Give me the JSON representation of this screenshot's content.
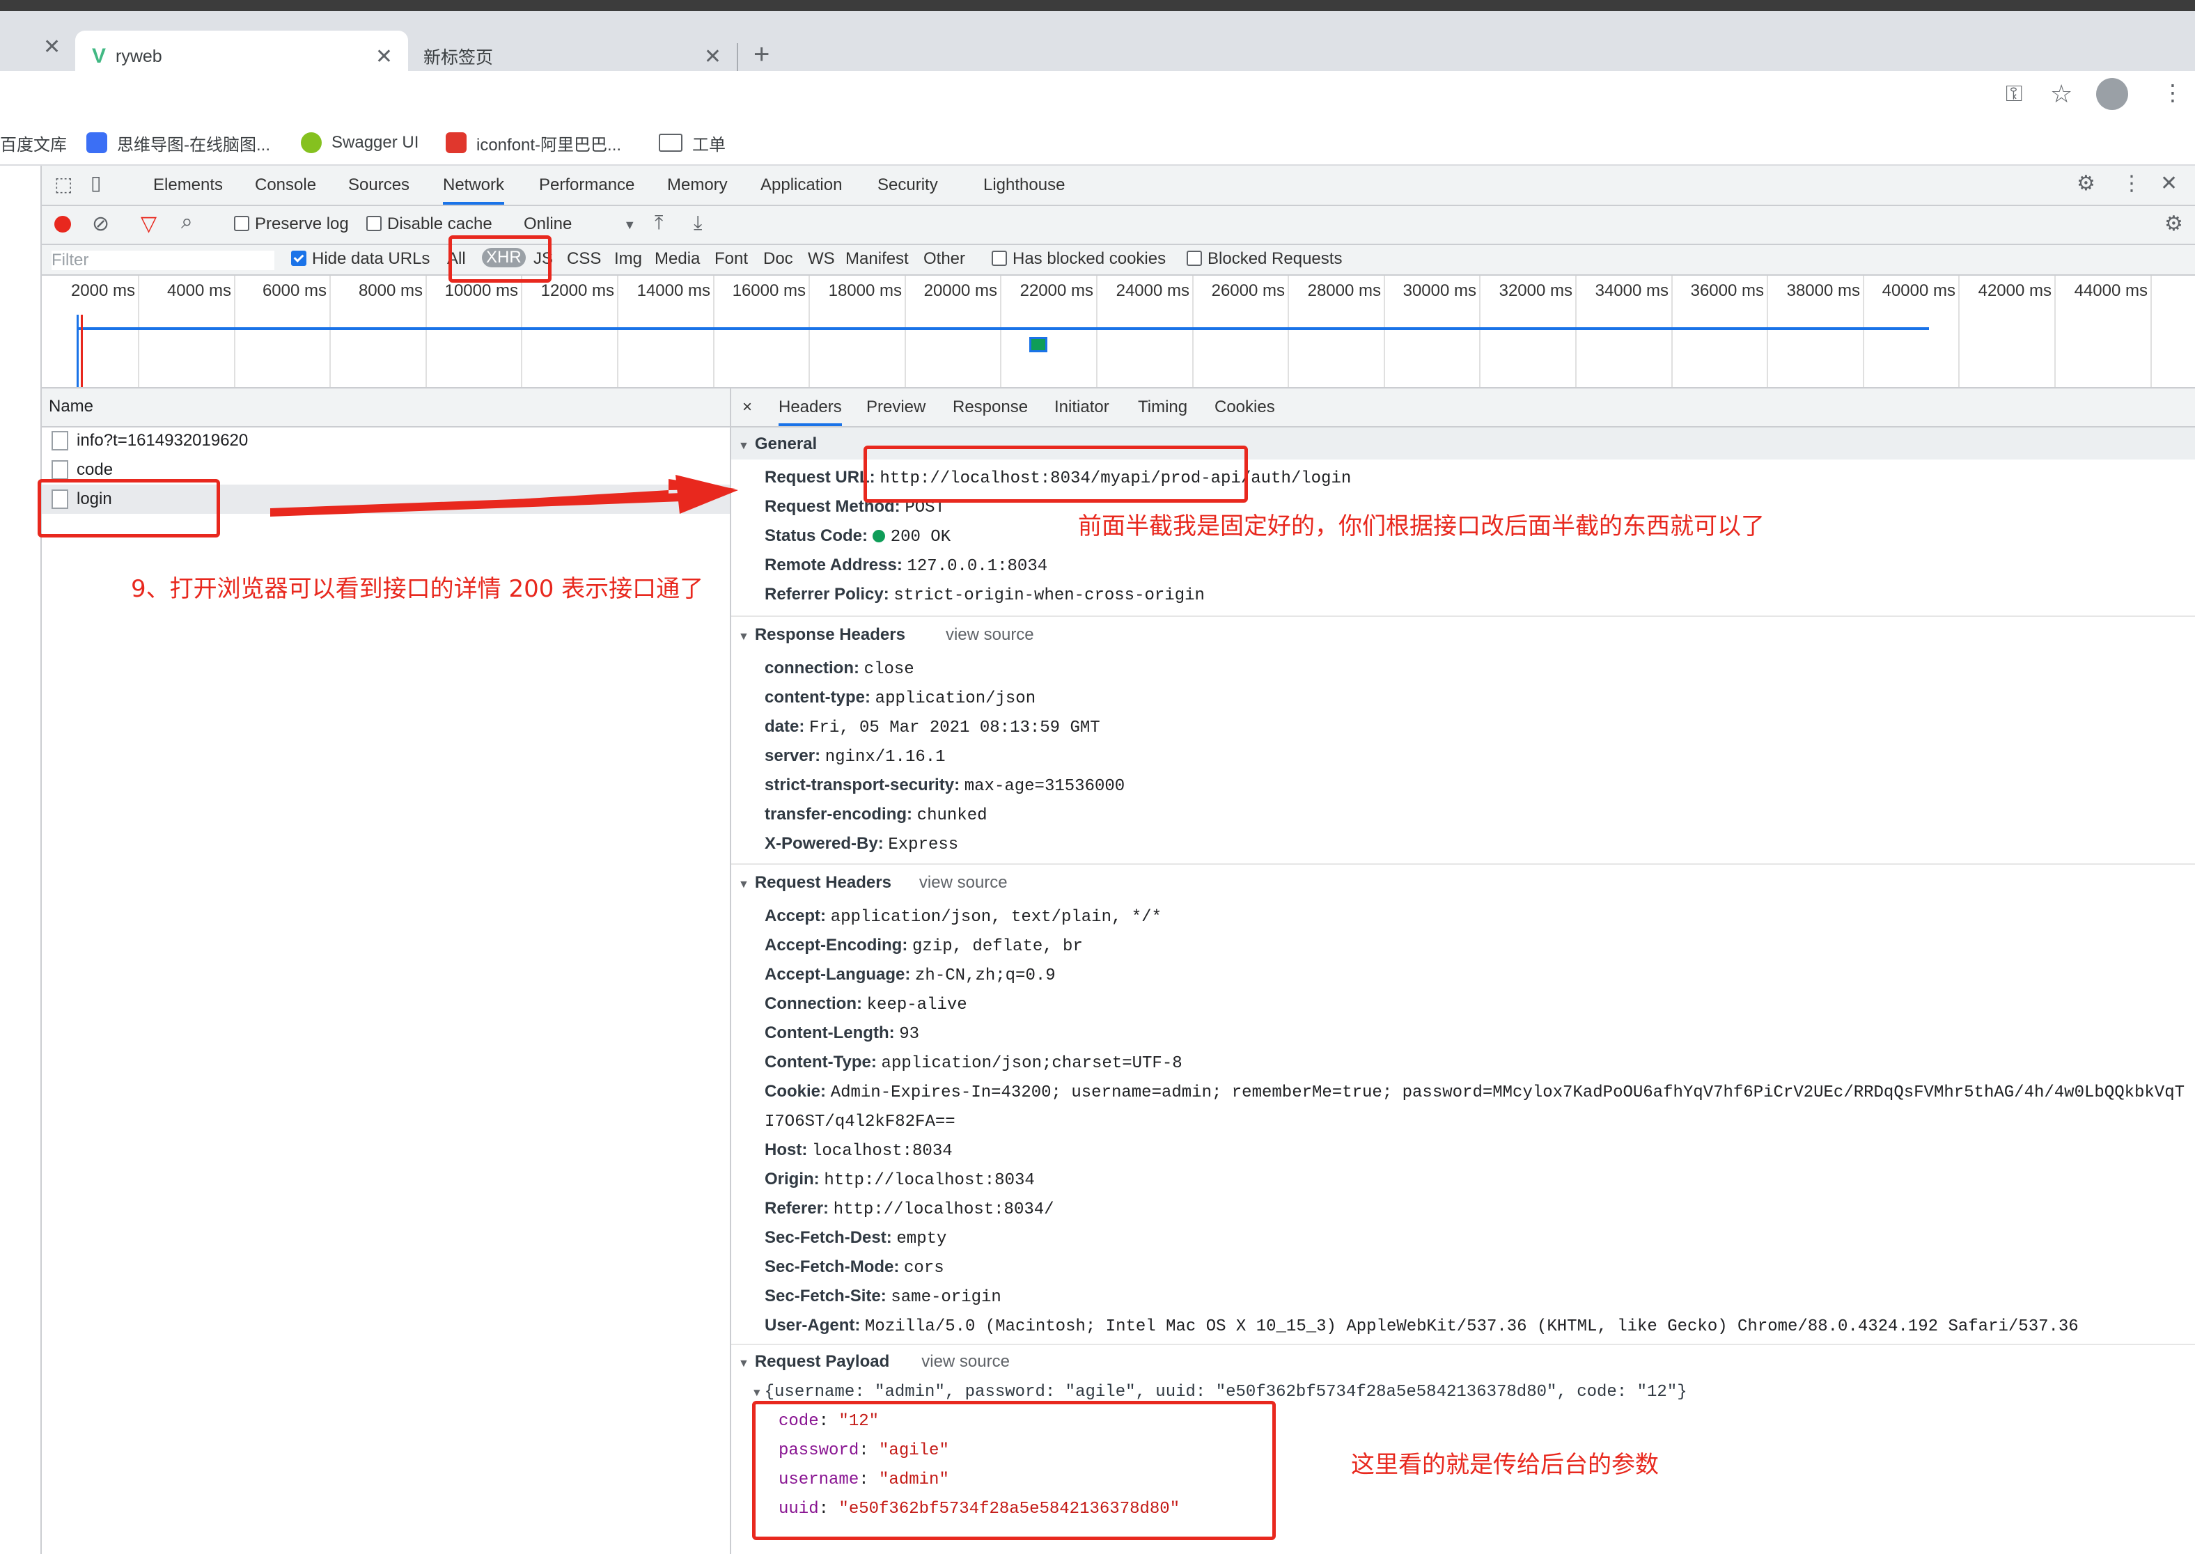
{
  "browser": {
    "tabs": [
      {
        "title": "ryweb"
      },
      {
        "title": "新标签页"
      }
    ],
    "bookmarks": [
      "百度文库",
      "思维导图-在线脑图...",
      "Swagger UI",
      "iconfont-阿里巴巴...",
      "工单"
    ]
  },
  "devtools": {
    "tabs": [
      "Elements",
      "Console",
      "Sources",
      "Network",
      "Performance",
      "Memory",
      "Application",
      "Security",
      "Lighthouse"
    ],
    "active_tab": "Network",
    "actions": {
      "preserve_log": "Preserve log",
      "disable_cache": "Disable cache",
      "throttle": "Online"
    },
    "filter": {
      "placeholder": "Filter",
      "hide_data_urls": "Hide data URLs",
      "types": [
        "All",
        "XHR",
        "JS",
        "CSS",
        "Img",
        "Media",
        "Font",
        "Doc",
        "WS",
        "Manifest",
        "Other"
      ],
      "active_type": "XHR",
      "has_blocked_cookies": "Has blocked cookies",
      "blocked_requests": "Blocked Requests"
    },
    "timeline_ticks": [
      "2000 ms",
      "4000 ms",
      "6000 ms",
      "8000 ms",
      "10000 ms",
      "12000 ms",
      "14000 ms",
      "16000 ms",
      "18000 ms",
      "20000 ms",
      "22000 ms",
      "24000 ms",
      "26000 ms",
      "28000 ms",
      "30000 ms",
      "32000 ms",
      "34000 ms",
      "36000 ms",
      "38000 ms",
      "40000 ms",
      "42000 ms",
      "44000 ms",
      "46"
    ],
    "requests": {
      "header": "Name",
      "rows": [
        "info?t=1614932019620",
        "code",
        "login"
      ]
    },
    "detail_tabs": [
      "Headers",
      "Preview",
      "Response",
      "Initiator",
      "Timing",
      "Cookies"
    ],
    "close": "×",
    "general": {
      "title": "General",
      "rows": [
        {
          "k": "Request URL:",
          "v": "http://localhost:8034/myapi/prod-api/auth/login"
        },
        {
          "k": "Request Method:",
          "v": "POST"
        },
        {
          "k": "Status Code:",
          "v": "200 OK"
        },
        {
          "k": "Remote Address:",
          "v": "127.0.0.1:8034"
        },
        {
          "k": "Referrer Policy:",
          "v": "strict-origin-when-cross-origin"
        }
      ]
    },
    "response_headers": {
      "title": "Response Headers",
      "view_source": "view source",
      "rows": [
        {
          "k": "connection:",
          "v": "close"
        },
        {
          "k": "content-type:",
          "v": "application/json"
        },
        {
          "k": "date:",
          "v": "Fri, 05 Mar 2021 08:13:59 GMT"
        },
        {
          "k": "server:",
          "v": "nginx/1.16.1"
        },
        {
          "k": "strict-transport-security:",
          "v": "max-age=31536000"
        },
        {
          "k": "transfer-encoding:",
          "v": "chunked"
        },
        {
          "k": "X-Powered-By:",
          "v": "Express"
        }
      ]
    },
    "request_headers": {
      "title": "Request Headers",
      "view_source": "view source",
      "rows": [
        {
          "k": "Accept:",
          "v": "application/json, text/plain, */*"
        },
        {
          "k": "Accept-Encoding:",
          "v": "gzip, deflate, br"
        },
        {
          "k": "Accept-Language:",
          "v": "zh-CN,zh;q=0.9"
        },
        {
          "k": "Connection:",
          "v": "keep-alive"
        },
        {
          "k": "Content-Length:",
          "v": "93"
        },
        {
          "k": "Content-Type:",
          "v": "application/json;charset=UTF-8"
        },
        {
          "k": "Cookie:",
          "v": "Admin-Expires-In=43200; username=admin; rememberMe=true; password=MMcylox7KadPoOU6afhYqV7hf6PiCrV2UEc/RRDqQsFVMhr5thAG/4h/4w0LbQQkbkVqT"
        },
        {
          "k": "",
          "v": "I7O6ST/q4l2kF82FA=="
        },
        {
          "k": "Host:",
          "v": "localhost:8034"
        },
        {
          "k": "Origin:",
          "v": "http://localhost:8034"
        },
        {
          "k": "Referer:",
          "v": "http://localhost:8034/"
        },
        {
          "k": "Sec-Fetch-Dest:",
          "v": "empty"
        },
        {
          "k": "Sec-Fetch-Mode:",
          "v": "cors"
        },
        {
          "k": "Sec-Fetch-Site:",
          "v": "same-origin"
        },
        {
          "k": "User-Agent:",
          "v": "Mozilla/5.0 (Macintosh; Intel Mac OS X 10_15_3) AppleWebKit/537.36 (KHTML, like Gecko) Chrome/88.0.4324.192 Safari/537.36"
        }
      ]
    },
    "payload": {
      "title": "Request Payload",
      "view_source": "view source",
      "summary": "{username: \"admin\", password: \"agile\", uuid: \"e50f362bf5734f28a5e5842136378d80\", code: \"12\"}",
      "rows": [
        {
          "k": "code",
          "v": "\"12\""
        },
        {
          "k": "password",
          "v": "\"agile\""
        },
        {
          "k": "username",
          "v": "\"admin\""
        },
        {
          "k": "uuid",
          "v": "\"e50f362bf5734f28a5e5842136378d80\""
        }
      ]
    }
  },
  "annotations": {
    "step9": "9、打开浏览器可以看到接口的详情 200 表示接口通了",
    "url_note": "前面半截我是固定好的，你们根据接口改后面半截的东西就可以了",
    "payload_note": "这里看的就是传给后台的参数"
  },
  "colors": {
    "accent": "#1a73e8",
    "annotation": "#e8281e",
    "status_ok": "#0f9d58"
  }
}
